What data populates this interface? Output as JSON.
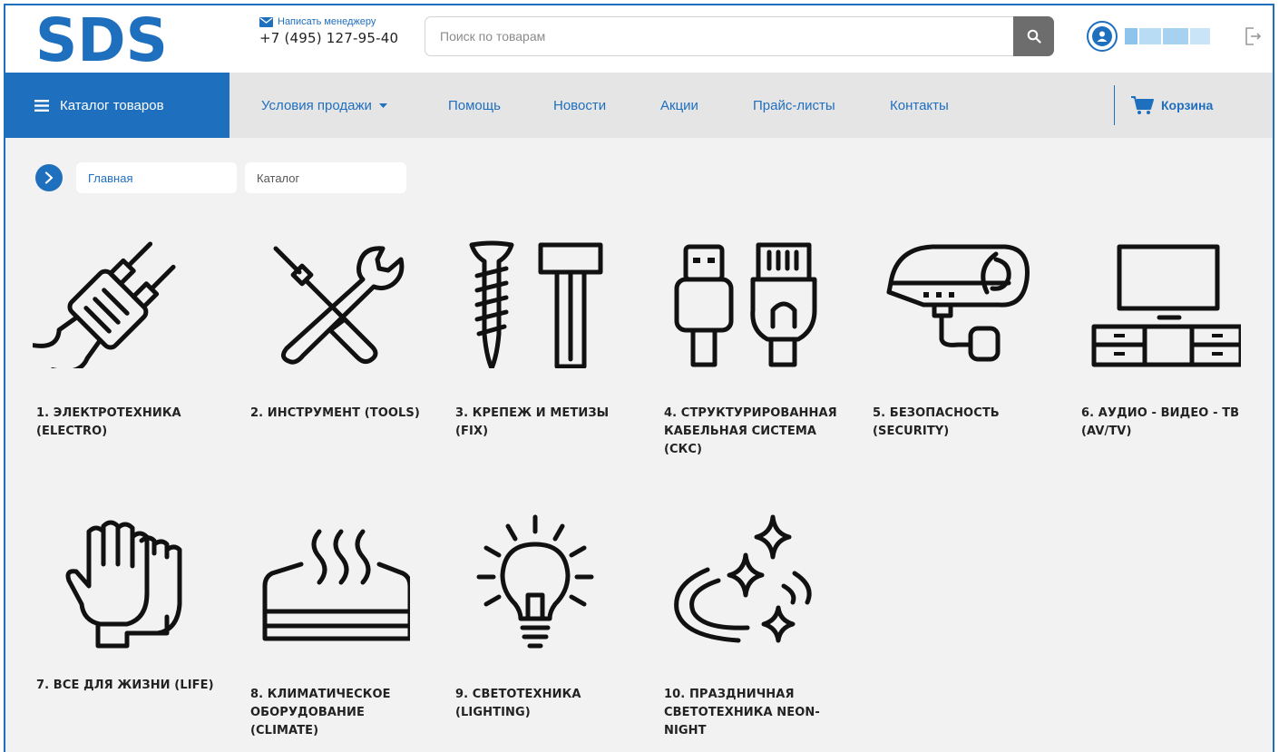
{
  "header": {
    "logo_text": "SDS",
    "mail_link": "Написать менеджеру",
    "phone": "+7 (495) 127-95-40",
    "search_placeholder": "Поиск по товарам"
  },
  "nav": {
    "catalog": "Каталог товаров",
    "items": [
      "Условия продажи",
      "Помощь",
      "Новости",
      "Акции",
      "Прайс-листы",
      "Контакты"
    ],
    "cart": "Корзина"
  },
  "breadcrumb": [
    "Главная",
    "Каталог"
  ],
  "categories": [
    {
      "label": "1. ЭЛЕКТРОТЕХНИКА (ELECTRO)",
      "icon": "plug-icon"
    },
    {
      "label": "2. ИНСТРУМЕНТ (TOOLS)",
      "icon": "tools-icon"
    },
    {
      "label": "3. КРЕПЕЖ И МЕТИЗЫ (FIX)",
      "icon": "fasteners-icon"
    },
    {
      "label": "4. СТРУКТУРИРОВАННАЯ КАБЕЛЬНАЯ СИСТЕМА (СКС)",
      "icon": "cable-connectors-icon"
    },
    {
      "label": "5. БЕЗОПАСНОСТЬ (SECURITY)",
      "icon": "security-camera-icon"
    },
    {
      "label": "6. АУДИО - ВИДЕО - ТВ (AV/TV)",
      "icon": "tv-stand-icon"
    },
    {
      "label": "7. ВСЕ ДЛЯ ЖИЗНИ (LIFE)",
      "icon": "gloves-icon"
    },
    {
      "label": "8. КЛИМАТИЧЕСКОЕ ОБОРУДОВАНИЕ (CLIMATE)",
      "icon": "heater-icon"
    },
    {
      "label": "9. СВЕТОТЕХНИКА (LIGHTING)",
      "icon": "light-bulb-icon"
    },
    {
      "label": "10. ПРАЗДНИЧНАЯ СВЕТОТЕХНИКА NEON-NIGHT",
      "icon": "sparkles-icon"
    }
  ],
  "colors": {
    "brand": "#1f6fbf",
    "nav_bg": "#e5e5e5",
    "page_bg": "#f2f2f2"
  }
}
